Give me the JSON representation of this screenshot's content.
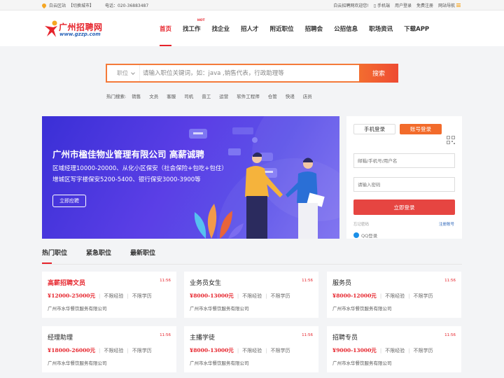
{
  "topbar": {
    "site_name": "白云区站",
    "switch_city": "【切换城市】",
    "phone": "电话：020-36883487",
    "welcome": "白云招聘网欢迎您!",
    "mobile": "手机端",
    "login": "用户登录",
    "register": "免费注册",
    "site_nav": "网站导航"
  },
  "logo": {
    "name": "广州招聘网",
    "url": "www.gzzp.com"
  },
  "nav": {
    "items": [
      {
        "label": "首页",
        "active": true
      },
      {
        "label": "找工作",
        "badge": "HOT"
      },
      {
        "label": "找企业"
      },
      {
        "label": "招人才"
      },
      {
        "label": "附近职位"
      },
      {
        "label": "招聘会"
      },
      {
        "label": "公招信息"
      },
      {
        "label": "职场资讯"
      },
      {
        "label": "下载APP"
      }
    ]
  },
  "search": {
    "category": "职位",
    "placeholder": "请输入职位关键词，如：java ,销售代表，行政助理等",
    "button": "搜索",
    "hot_label": "热门搜索:",
    "hot_terms": [
      "销售",
      "文员",
      "客服",
      "司机",
      "普工",
      "运营",
      "软件工程师",
      "仓管",
      "快递",
      "店员"
    ]
  },
  "banner": {
    "title": "广州市楹佳物业管理有限公司  高薪诚聘",
    "line1": "区域经理10000-20000、从化小区保安（社会保险+包吃+包住）",
    "line2": "增城区写字楼保安5200-5400、银行保安3000-3900等",
    "button": "立即应聘"
  },
  "login": {
    "tab_mobile": "手机登录",
    "tab_account": "账号登录",
    "username_placeholder": "邮箱/手机号/用户名",
    "password_placeholder": "请输入密码",
    "submit": "立即登录",
    "forgot": "忘记密码",
    "register": "注册账号",
    "qq": "QQ登录"
  },
  "job_tabs": [
    "热门职位",
    "紧急职位",
    "最新职位"
  ],
  "jobs": [
    {
      "title": "高薪招聘文员",
      "highlight": true,
      "time": "11:56",
      "salary": "¥12000-25000元",
      "exp": "不限经验",
      "edu": "不限学历",
      "company": "广州市水华餐饮服务有限公司"
    },
    {
      "title": "业务员女生",
      "highlight": false,
      "time": "11:56",
      "salary": "¥8000-13000元",
      "exp": "不限经验",
      "edu": "不限学历",
      "company": "广州市水华餐饮服务有限公司"
    },
    {
      "title": "服务员",
      "highlight": false,
      "time": "11:56",
      "salary": "¥8000-12000元",
      "exp": "不限经验",
      "edu": "不限学历",
      "company": "广州市水华餐饮服务有限公司"
    },
    {
      "title": "经理助理",
      "highlight": false,
      "time": "11:56",
      "salary": "¥18000-26000元",
      "exp": "不限经验",
      "edu": "不限学历",
      "company": "广州市水华餐饮服务有限公司"
    },
    {
      "title": "主播学徒",
      "highlight": false,
      "time": "11:56",
      "salary": "¥8000-13000元",
      "exp": "不限经验",
      "edu": "不限学历",
      "company": "广州市水华餐饮服务有限公司"
    },
    {
      "title": "招聘专员",
      "highlight": false,
      "time": "11:56",
      "salary": "¥9000-13000元",
      "exp": "不限经验",
      "edu": "不限学历",
      "company": "广州市水华餐饮服务有限公司"
    }
  ],
  "colors": {
    "brand_red": "#e6232b",
    "orange": "#f26b2b",
    "banner_purple": "#4a3be0"
  }
}
